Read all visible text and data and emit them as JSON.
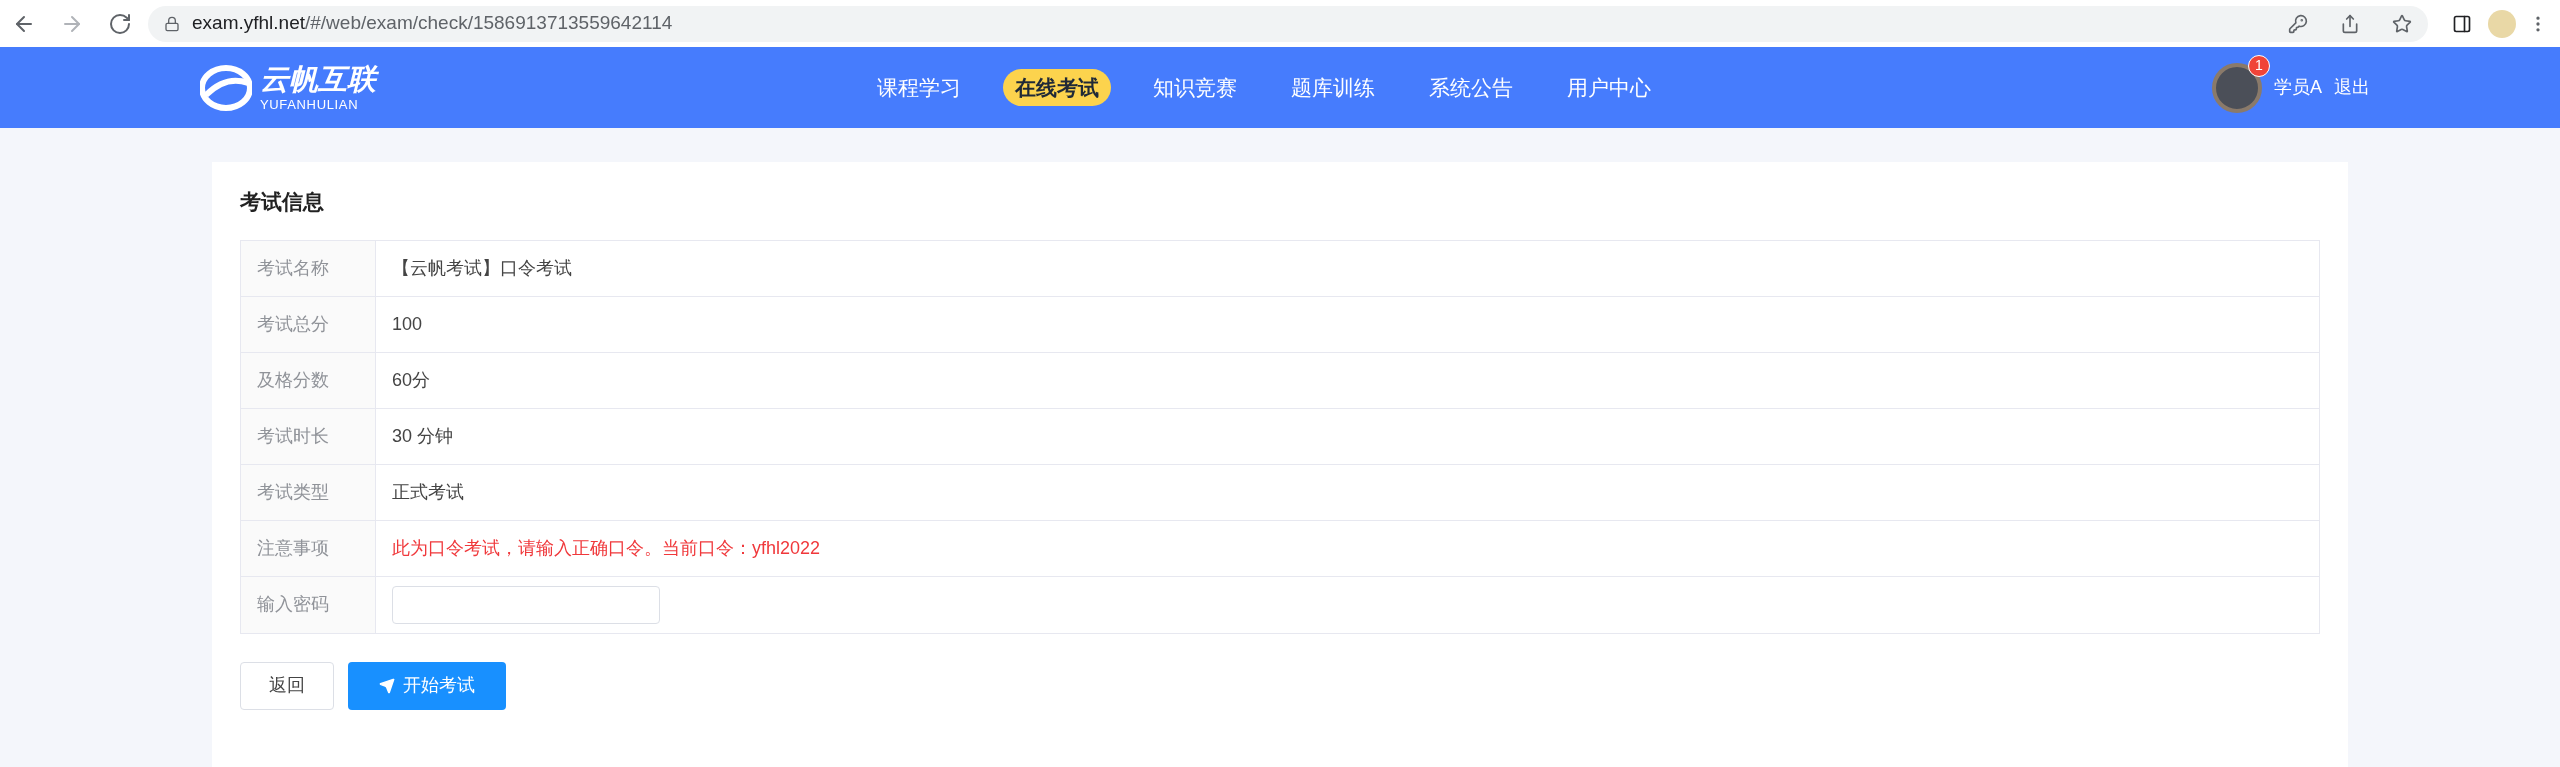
{
  "browser": {
    "url_host": "exam.yfhl.net",
    "url_path": "/#/web/exam/check/1586913713559642114"
  },
  "header": {
    "logo_title": "云帆互联",
    "logo_subtitle": "YUFANHULIAN",
    "nav": [
      {
        "label": "课程学习",
        "selected": false
      },
      {
        "label": "在线考试",
        "selected": true
      },
      {
        "label": "知识竞赛",
        "selected": false
      },
      {
        "label": "题库训练",
        "selected": false
      },
      {
        "label": "系统公告",
        "selected": false
      },
      {
        "label": "用户中心",
        "selected": false
      }
    ],
    "badge": "1",
    "user": "学员A",
    "logout": "退出"
  },
  "card": {
    "title": "考试信息",
    "rows": [
      {
        "kind": "text",
        "label": "考试名称",
        "value": "【云帆考试】口令考试"
      },
      {
        "kind": "text",
        "label": "考试总分",
        "value": "100"
      },
      {
        "kind": "text",
        "label": "及格分数",
        "value": "60分"
      },
      {
        "kind": "text",
        "label": "考试时长",
        "value": "30 分钟"
      },
      {
        "kind": "text",
        "label": "考试类型",
        "value": "正式考试"
      },
      {
        "kind": "warning",
        "label": "注意事项",
        "value": "此为口令考试，请输入正确口令。当前口令：yfhl2022"
      },
      {
        "kind": "input",
        "label": "输入密码"
      }
    ],
    "buttons": {
      "back": "返回",
      "start": "开始考试"
    }
  }
}
